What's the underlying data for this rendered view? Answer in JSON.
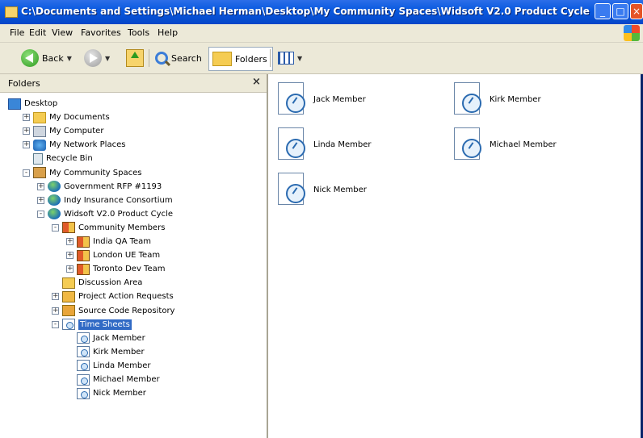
{
  "window": {
    "title": "C:\\Documents and Settings\\Michael Herman\\Desktop\\My Community Spaces\\Widsoft V2.0 Product Cycle"
  },
  "menu": [
    "File",
    "Edit",
    "View",
    "Favorites",
    "Tools",
    "Help"
  ],
  "toolbar": {
    "back_label": "Back",
    "search_label": "Search",
    "folders_label": "Folders"
  },
  "folders_pane": {
    "title": "Folders",
    "close_glyph": "×",
    "tree": [
      {
        "label": "Desktop",
        "icon": "desktop-icon",
        "expander": ""
      },
      {
        "label": "My Documents",
        "icon": "my-documents-icon",
        "expander": "+"
      },
      {
        "label": "My Computer",
        "icon": "my-computer-icon",
        "expander": "+"
      },
      {
        "label": "My Network Places",
        "icon": "network-places-icon",
        "expander": "+"
      },
      {
        "label": "Recycle Bin",
        "icon": "recycle-bin-icon",
        "expander": ""
      },
      {
        "label": "My Community Spaces",
        "icon": "community-spaces-icon",
        "expander": "-"
      },
      {
        "label": "Government RFP #1193",
        "icon": "globe-icon",
        "expander": "+"
      },
      {
        "label": "Indy Insurance Consortium",
        "icon": "globe-icon",
        "expander": "+"
      },
      {
        "label": "Widsoft V2.0 Product Cycle",
        "icon": "globe-icon",
        "expander": "-"
      },
      {
        "label": "Community Members",
        "icon": "members-icon",
        "expander": "-"
      },
      {
        "label": "India QA Team",
        "icon": "team-icon",
        "expander": "+"
      },
      {
        "label": "London UE Team",
        "icon": "team-icon",
        "expander": "+"
      },
      {
        "label": "Toronto Dev Team",
        "icon": "team-icon",
        "expander": "+"
      },
      {
        "label": "Discussion Area",
        "icon": "discussion-icon",
        "expander": ""
      },
      {
        "label": "Project Action Requests",
        "icon": "project-requests-icon",
        "expander": "+"
      },
      {
        "label": "Source Code Repository",
        "icon": "source-code-icon",
        "expander": "+"
      },
      {
        "label": "Time Sheets",
        "icon": "timesheet-icon",
        "expander": "-",
        "selected": true
      },
      {
        "label": "Jack Member",
        "icon": "timesheet-icon",
        "expander": ""
      },
      {
        "label": "Kirk Member",
        "icon": "timesheet-icon",
        "expander": ""
      },
      {
        "label": "Linda Member",
        "icon": "timesheet-icon",
        "expander": ""
      },
      {
        "label": "Michael Member",
        "icon": "timesheet-icon",
        "expander": ""
      },
      {
        "label": "Nick Member",
        "icon": "timesheet-icon",
        "expander": ""
      }
    ]
  },
  "content": {
    "items": [
      {
        "label": "Jack Member",
        "icon": "timesheet-icon"
      },
      {
        "label": "Kirk Member",
        "icon": "timesheet-icon"
      },
      {
        "label": "Linda Member",
        "icon": "timesheet-icon"
      },
      {
        "label": "Michael Member",
        "icon": "timesheet-icon"
      },
      {
        "label": "Nick Member",
        "icon": "timesheet-icon"
      }
    ]
  }
}
